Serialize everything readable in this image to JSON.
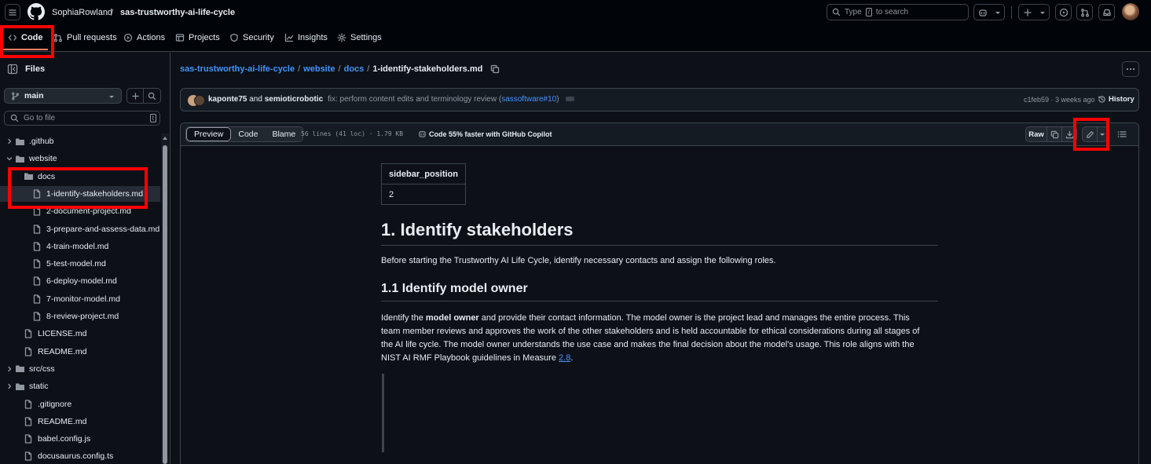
{
  "header": {
    "owner": "SophiaRowland",
    "separator": "/",
    "repo": "sas-trustworthy-ai-life-cycle",
    "search_placeholder_prefix": "Type",
    "search_key": "/",
    "search_placeholder_suffix": "to search"
  },
  "repo_tabs": [
    {
      "label": "Code",
      "icon": "code-icon"
    },
    {
      "label": "Pull requests",
      "icon": "git-pull-request-icon"
    },
    {
      "label": "Actions",
      "icon": "play-icon"
    },
    {
      "label": "Projects",
      "icon": "table-icon"
    },
    {
      "label": "Security",
      "icon": "shield-icon"
    },
    {
      "label": "Insights",
      "icon": "graph-icon"
    },
    {
      "label": "Settings",
      "icon": "gear-icon"
    }
  ],
  "sidebar": {
    "title": "Files",
    "branch": "main",
    "go_to_file": "Go to file",
    "go_to_file_key": "t",
    "tree": [
      {
        "label": ".github",
        "type": "folder",
        "expanded": false
      },
      {
        "label": "website",
        "type": "folder",
        "expanded": true
      },
      {
        "label": "docs",
        "type": "folder",
        "expanded": true
      },
      {
        "label": "1-identify-stakeholders.md",
        "type": "file",
        "selected": true
      },
      {
        "label": "2-document-project.md",
        "type": "file"
      },
      {
        "label": "3-prepare-and-assess-data.md",
        "type": "file"
      },
      {
        "label": "4-train-model.md",
        "type": "file"
      },
      {
        "label": "5-test-model.md",
        "type": "file"
      },
      {
        "label": "6-deploy-model.md",
        "type": "file"
      },
      {
        "label": "7-monitor-model.md",
        "type": "file"
      },
      {
        "label": "8-review-project.md",
        "type": "file"
      },
      {
        "label": "LICENSE.md",
        "type": "file"
      },
      {
        "label": "README.md",
        "type": "file"
      },
      {
        "label": "src/css",
        "type": "folder",
        "expanded": false
      },
      {
        "label": "static",
        "type": "folder",
        "expanded": false
      },
      {
        "label": ".gitignore",
        "type": "file"
      },
      {
        "label": "README.md",
        "type": "file"
      },
      {
        "label": "babel.config.js",
        "type": "file"
      },
      {
        "label": "docusaurus.config.ts",
        "type": "file"
      }
    ]
  },
  "path": {
    "segments": [
      "sas-trustworthy-ai-life-cycle",
      "website",
      "docs"
    ],
    "current": "1-identify-stakeholders.md"
  },
  "commit": {
    "author1": "kaponte75",
    "and": "and",
    "author2": "semioticrobotic",
    "message": "fix: perform content edits and terminology review (",
    "pr_link": "sassoftware#10",
    "message_end": ")",
    "sha_time": "c1feb59 · 3 weeks ago",
    "history": "History"
  },
  "file_toolbar": {
    "tabs": [
      "Preview",
      "Code",
      "Blame"
    ],
    "active_tab": "Preview",
    "meta": "56 lines (41 loc) · 1.79 KB",
    "copilot": "Code 55% faster with GitHub Copilot",
    "raw": "Raw"
  },
  "markdown": {
    "frontmatter_key": "sidebar_position",
    "frontmatter_value": "2",
    "h1": "1. Identify stakeholders",
    "p1": "Before starting the Trustworthy AI Life Cycle, identify necessary contacts and assign the following roles.",
    "h2": "1.1 Identify model owner",
    "p2_start": "Identify the ",
    "p2_bold": "model owner",
    "p2_rest": " and provide their contact information. The model owner is the project lead and manages the entire process. This team member reviews and approves the work of the other stakeholders and is held accountable for ethical considerations during all stages of the AI life cycle. The model owner understands the use case and makes the final decision about the model's usage. This role aligns with the NIST AI RMF Playbook guidelines in Measure ",
    "p2_link": "2.8",
    "p2_end": "."
  },
  "colors": {
    "accent_link": "#4493f8",
    "highlight": "#ff0000",
    "tab_underline": "#f78166"
  }
}
